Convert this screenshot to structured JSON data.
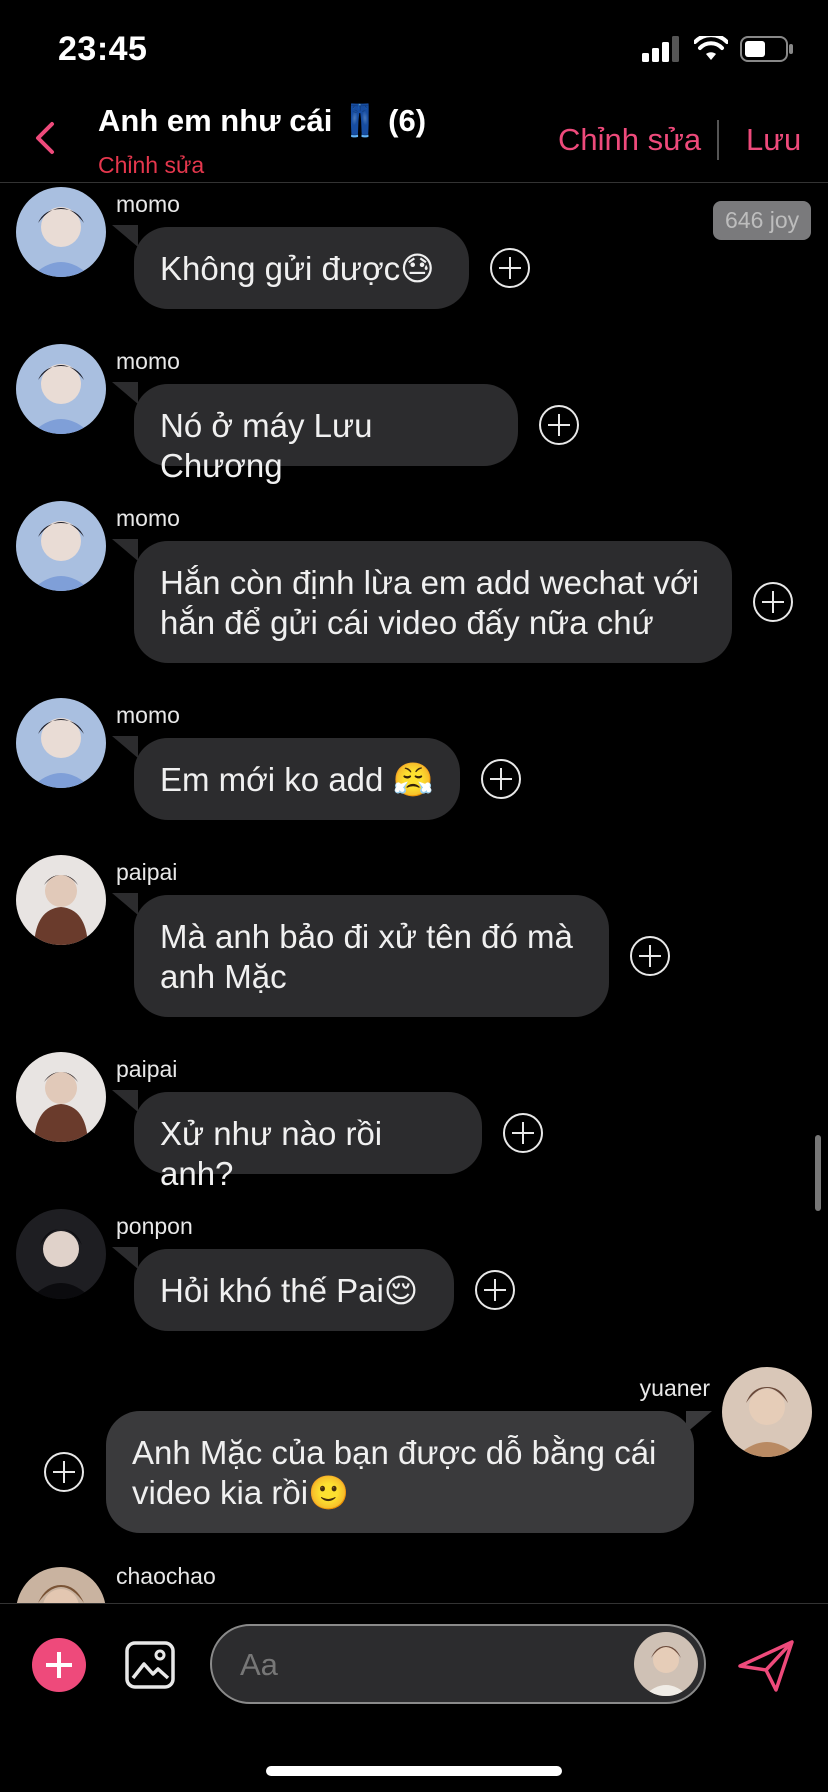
{
  "status": {
    "time": "23:45"
  },
  "header": {
    "title": "Anh em như cái 👖 (6)",
    "subtitle": "Chỉnh sửa",
    "edit_label": "Chỉnh sửa",
    "save_label": "Lưu",
    "accent": "#ee4a7b"
  },
  "badge": {
    "text": "646 joy"
  },
  "messages": [
    {
      "sender": "momo",
      "text": "Không gửi được😓"
    },
    {
      "sender": "momo",
      "text": "Nó ở máy Lưu Chương"
    },
    {
      "sender": "momo",
      "text": "Hắn còn định lừa em add wechat với hắn để gửi cái video đấy nữa chứ"
    },
    {
      "sender": "momo",
      "text": "Em mới ko add 😤"
    },
    {
      "sender": "paipai",
      "text": "Mà anh bảo đi xử tên đó mà anh Mặc"
    },
    {
      "sender": "paipai",
      "text": "Xử như nào rồi anh?"
    },
    {
      "sender": "ponpon",
      "text": "Hỏi khó thế Pai😌"
    },
    {
      "sender": "yuaner",
      "text": "Anh Mặc của bạn được dỗ bằng cái video kia rồi🙂"
    },
    {
      "sender": "chaochao",
      "text": ""
    }
  ],
  "composer": {
    "placeholder": "Aa"
  }
}
